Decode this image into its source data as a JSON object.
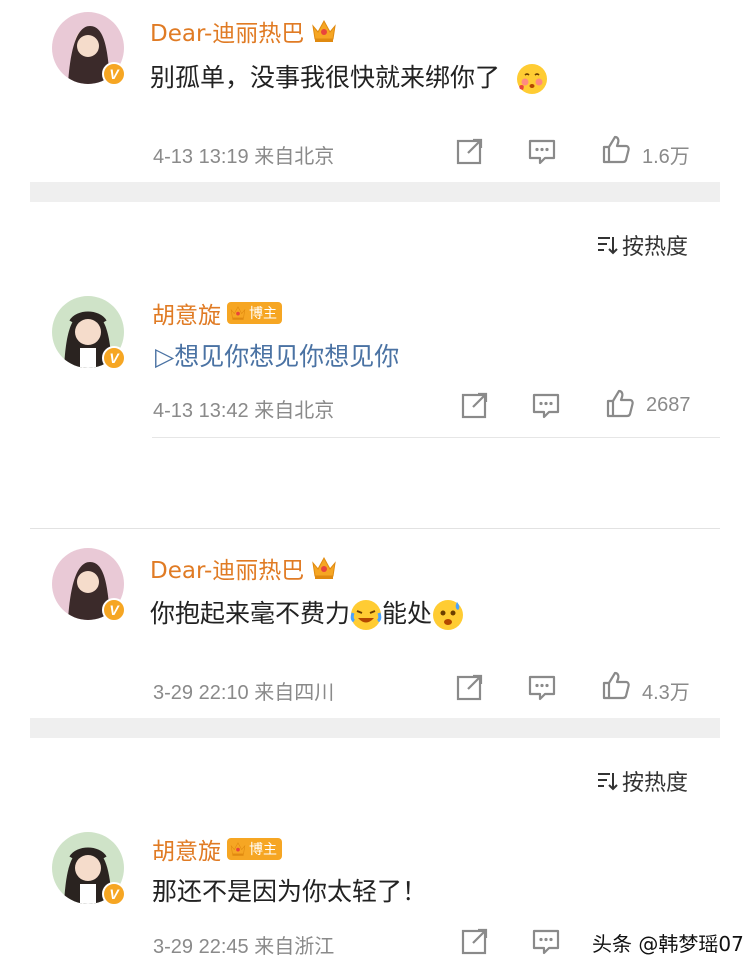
{
  "comments": [
    {
      "username": "Dear-迪丽热巴",
      "text": "别孤单，没事我很快就来绑你了",
      "emoji": "blush-face-emoji",
      "time": "4-13 13:19",
      "location": "来自北京",
      "likes": "1.6万"
    },
    {
      "username": "胡意旋",
      "badge": "博主",
      "text": "▷想见你想见你想见你",
      "time": "4-13 13:42",
      "location": "来自北京",
      "likes": "2687"
    },
    {
      "username": "Dear-迪丽热巴",
      "text_a": "你抱起来毫不费力",
      "text_b": "能处",
      "emoji_a": "laughing-crying-emoji",
      "emoji_b": "sweat-face-emoji",
      "time": "3-29 22:10",
      "location": "来自四川",
      "likes": "4.3万"
    },
    {
      "username": "胡意旋",
      "badge": "博主",
      "text": "那还不是因为你太轻了！",
      "time": "3-29 22:45",
      "location": "来自浙江"
    }
  ],
  "sort_label": "按热度",
  "watermark": "头条 @韩梦瑶07",
  "colors": {
    "username": "#e07b24",
    "link_text": "#4a72a3",
    "meta": "#8a8a8a",
    "badge": "#f6a623",
    "band": "#efefef"
  }
}
